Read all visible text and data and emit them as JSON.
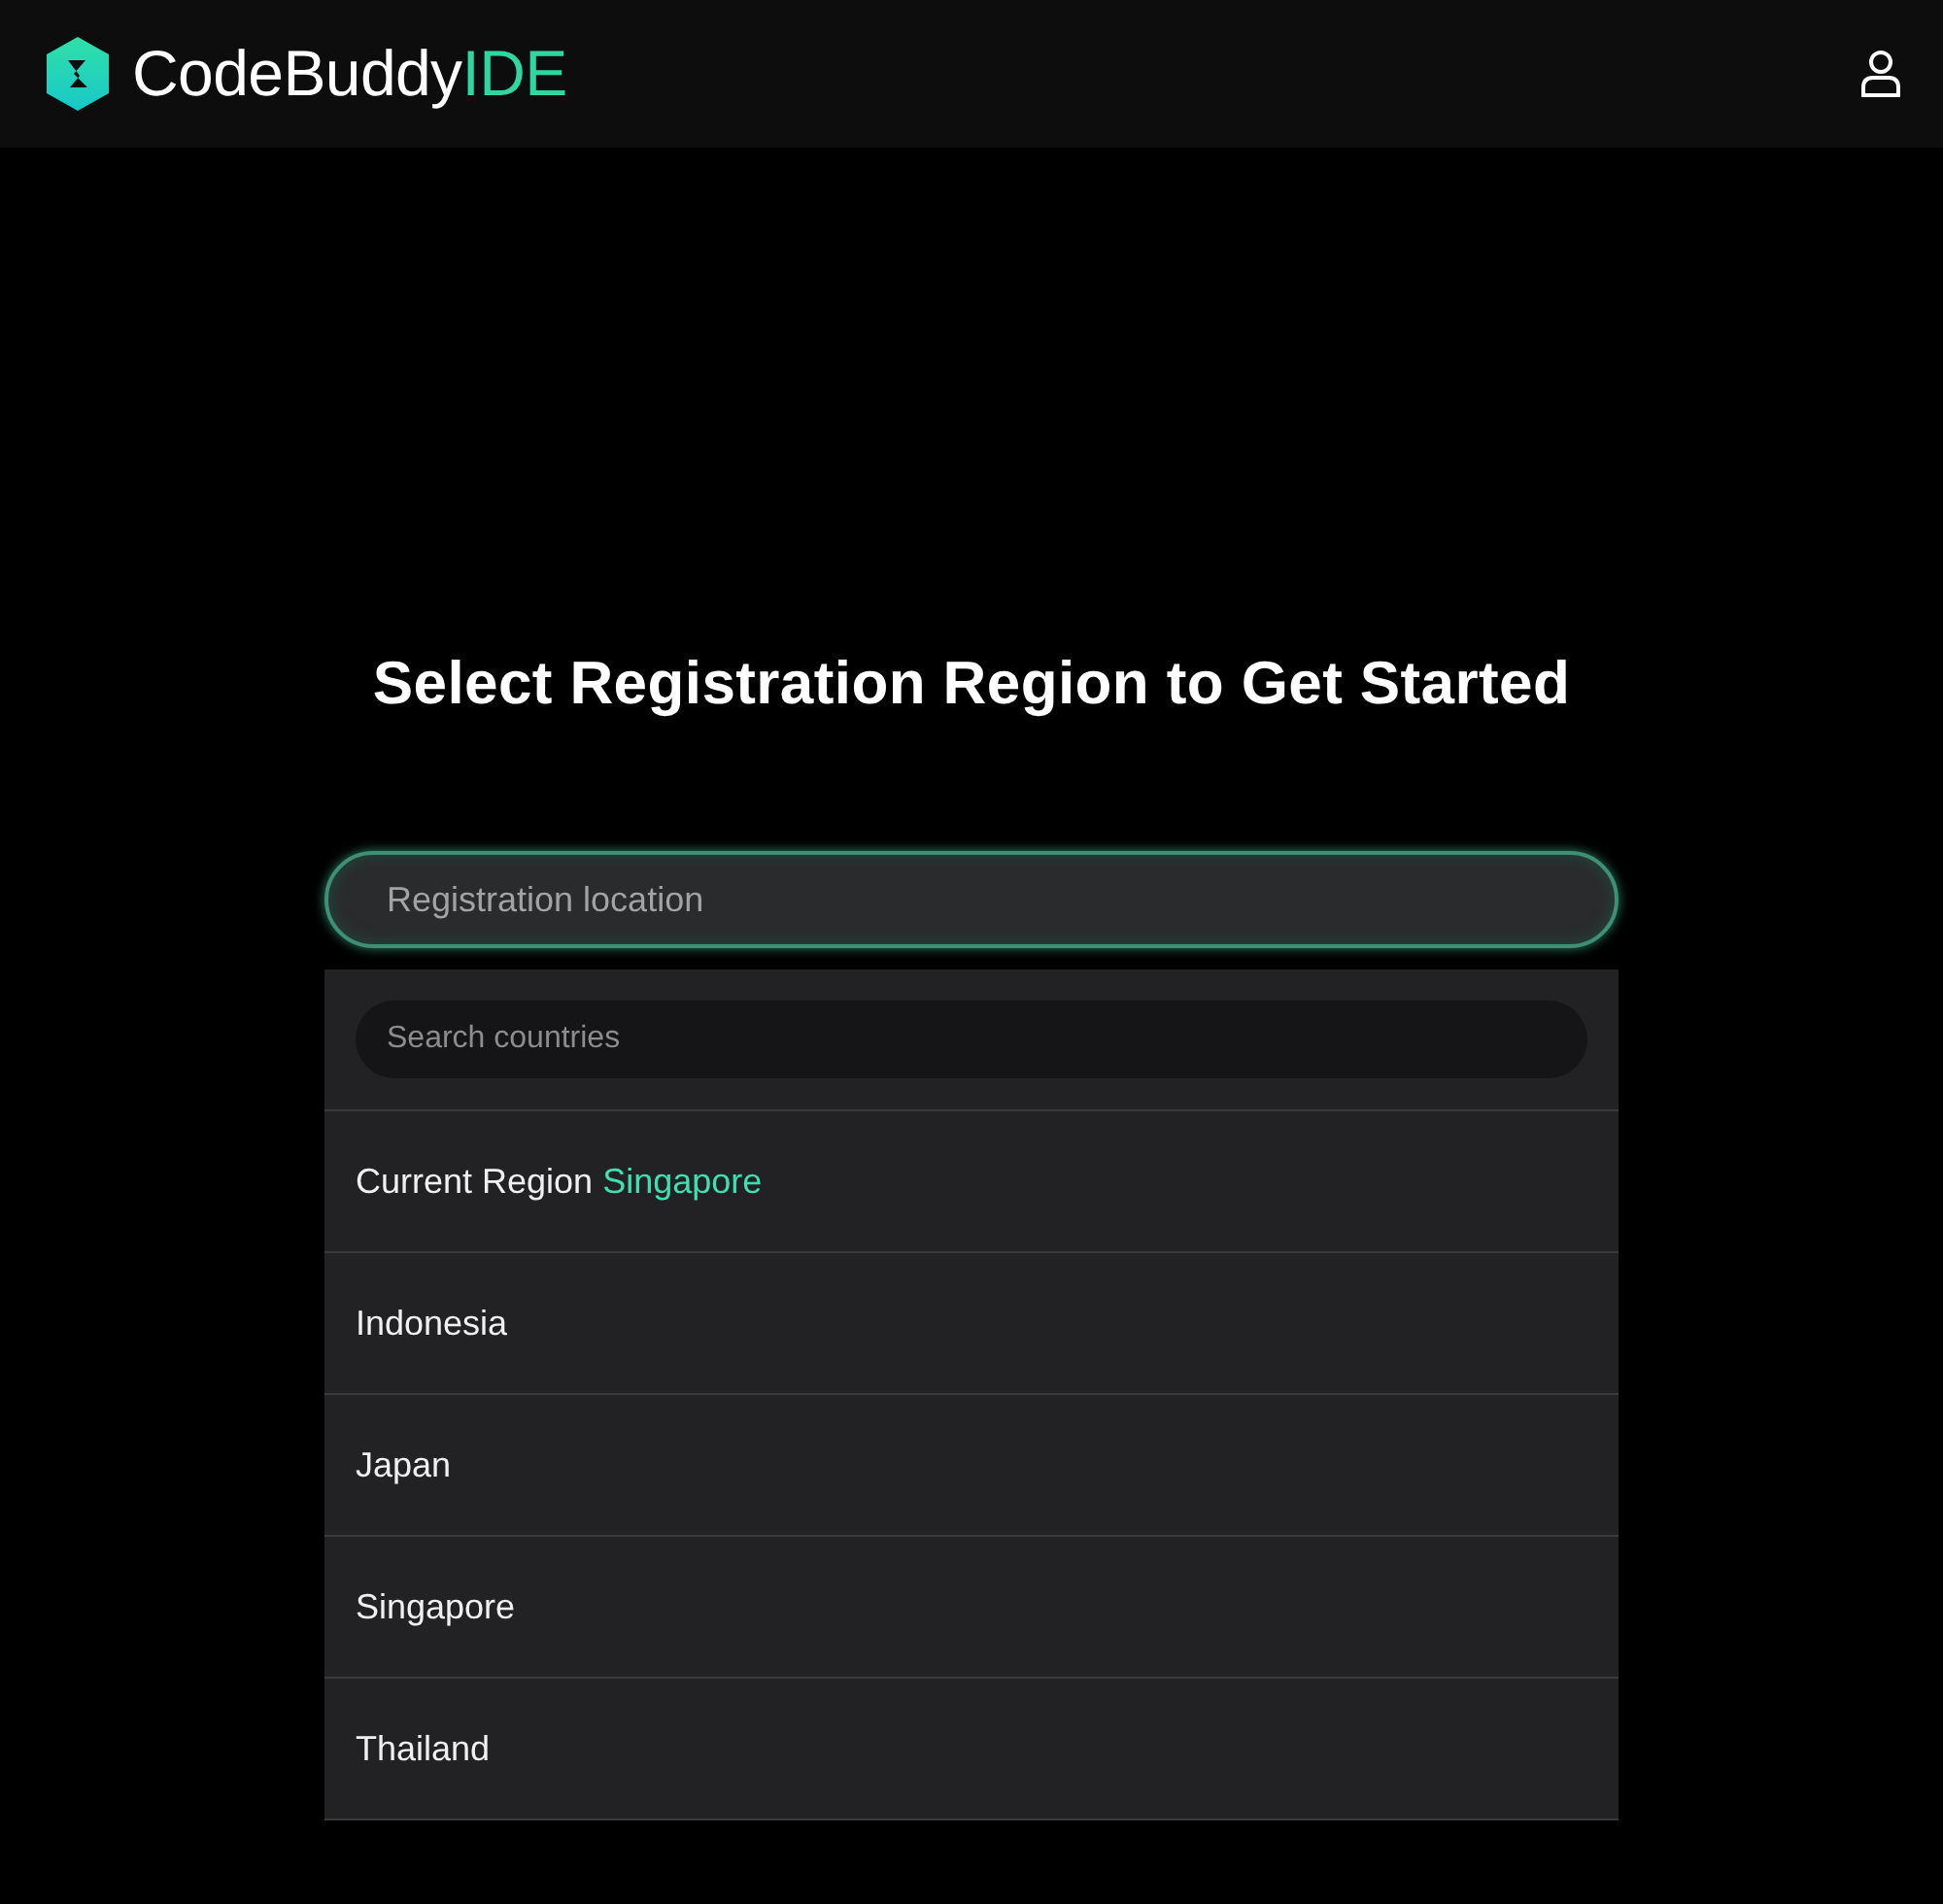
{
  "header": {
    "logo": {
      "name": "CodeBuddy",
      "suffix": "IDE"
    }
  },
  "title": "Select Registration Region to Get Started",
  "region_field": {
    "placeholder": "Registration location"
  },
  "dropdown": {
    "search": {
      "placeholder": "Search countries"
    },
    "items": [
      {
        "kind": "current",
        "label": "Current Region",
        "value": "Singapore"
      },
      {
        "kind": "country",
        "label": "Indonesia"
      },
      {
        "kind": "country",
        "label": "Japan"
      },
      {
        "kind": "country",
        "label": "Singapore"
      },
      {
        "kind": "country",
        "label": "Thailand"
      }
    ]
  }
}
